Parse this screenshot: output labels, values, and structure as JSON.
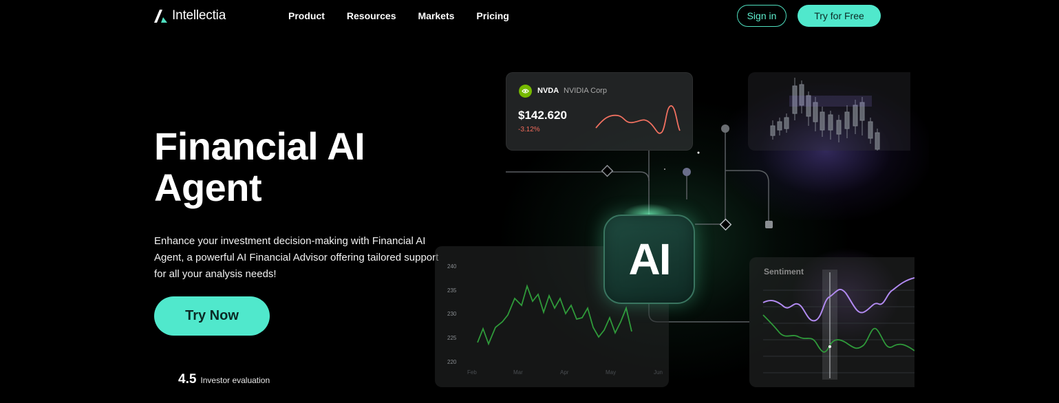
{
  "brand": {
    "name": "Intellectia"
  },
  "nav": {
    "items": [
      {
        "label": "Product"
      },
      {
        "label": "Resources"
      },
      {
        "label": "Markets"
      },
      {
        "label": "Pricing"
      }
    ],
    "signin_label": "Sign in",
    "try_label": "Try for Free"
  },
  "hero": {
    "title_line1": "Financial AI",
    "title_line2": "Agent",
    "description": "Enhance your investment decision-making with Financial AI Agent, a powerful AI Financial Advisor offering tailored support for all your analysis needs!",
    "cta_label": "Try Now",
    "rating_value": "4.5",
    "rating_label": "Investor evaluation"
  },
  "stock_card": {
    "ticker": "NVDA",
    "company": "NVIDIA Corp",
    "price": "$142.620",
    "change": "-3.12%"
  },
  "ai_badge": {
    "text": "AI"
  },
  "price_chart": {
    "y_ticks": [
      "240",
      "235",
      "230",
      "225",
      "220"
    ],
    "x_ticks": [
      "Feb",
      "Mar",
      "Apr",
      "May",
      "Jun"
    ]
  },
  "sentiment": {
    "title": "Sentiment"
  },
  "colors": {
    "accent": "#50e8cc",
    "loss": "#f06a5a",
    "nvidia": "#76b900",
    "chart_green": "#2f9a3a",
    "chart_violet": "#b18af0"
  },
  "icons": {
    "logo": "intellectia-logo-icon",
    "nvidia": "nvidia-icon"
  }
}
